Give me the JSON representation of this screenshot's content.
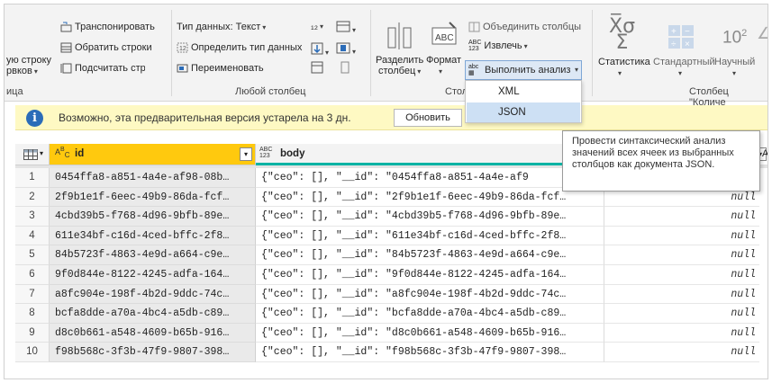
{
  "ribbon": {
    "left_cut": {
      "line1": "ую строку",
      "line2": "рвков",
      "group": "ица"
    },
    "transpose": "Транспонировать",
    "reverse_rows": "Обратить строки",
    "count_rows": "Подсчитать строки",
    "data_type": "Тип данных: Текст",
    "detect_type": "Определить тип данных",
    "rename": "Переименовать",
    "any_column_group": "Любой столбец",
    "split_column": {
      "line1": "Разделить",
      "line2": "столбец"
    },
    "format": "Формат",
    "merge_columns": "Объединить столбцы",
    "extract": "Извлечь",
    "parse": "Выполнить анализ",
    "text_column_group": "Стол",
    "statistics": "Статистика",
    "standard": "Стандартный",
    "scientific": "Научный",
    "number_column_group": "Столбец \"Количе",
    "ten_squared": "10",
    "ten_exp": "2",
    "abc": "ABC",
    "abc123": "ABC\n123"
  },
  "menu": {
    "items": [
      "XML",
      "JSON"
    ],
    "hovered_index": 1
  },
  "tooltip": "Провести синтаксический анализ значений всех ячеек из выбранных столбцов как документа JSON.",
  "infobar": {
    "message": "Возможно, эта предварительная версия устарела на 3 дн.",
    "refresh": "Обновить"
  },
  "grid": {
    "columns": [
      {
        "type_icon": "A B C",
        "name": "id"
      },
      {
        "type_icon": "ABC 123",
        "name": "body"
      }
    ],
    "last_header_letter": "A",
    "rows": [
      {
        "n": "1",
        "id": "0454ffa8-a851-4a4e-af98-08b…",
        "body": "{\"ceo\": [], \"__id\": \"0454ffa8-a851-4a4e-af9",
        "extra": "null"
      },
      {
        "n": "2",
        "id": "2f9b1e1f-6eec-49b9-86da-fcf…",
        "body": "{\"ceo\": [], \"__id\": \"2f9b1e1f-6eec-49b9-86da-fcf…",
        "extra": "null"
      },
      {
        "n": "3",
        "id": "4cbd39b5-f768-4d96-9bfb-89e…",
        "body": "{\"ceo\": [], \"__id\": \"4cbd39b5-f768-4d96-9bfb-89e…",
        "extra": "null"
      },
      {
        "n": "4",
        "id": "611e34bf-c16d-4ced-bffc-2f8…",
        "body": "{\"ceo\": [], \"__id\": \"611e34bf-c16d-4ced-bffc-2f8…",
        "extra": "null"
      },
      {
        "n": "5",
        "id": "84b5723f-4863-4e9d-a664-c9e…",
        "body": "{\"ceo\": [], \"__id\": \"84b5723f-4863-4e9d-a664-c9e…",
        "extra": "null"
      },
      {
        "n": "6",
        "id": "9f0d844e-8122-4245-adfa-164…",
        "body": "{\"ceo\": [], \"__id\": \"9f0d844e-8122-4245-adfa-164…",
        "extra": "null"
      },
      {
        "n": "7",
        "id": "a8fc904e-198f-4b2d-9ddc-74c…",
        "body": "{\"ceo\": [], \"__id\": \"a8fc904e-198f-4b2d-9ddc-74c…",
        "extra": "null"
      },
      {
        "n": "8",
        "id": "bcfa8dde-a70a-4bc4-a5db-c89…",
        "body": "{\"ceo\": [], \"__id\": \"bcfa8dde-a70a-4bc4-a5db-c89…",
        "extra": "null"
      },
      {
        "n": "9",
        "id": "d8c0b661-a548-4609-b65b-916…",
        "body": "{\"ceo\": [], \"__id\": \"d8c0b661-a548-4609-b65b-916…",
        "extra": "null"
      },
      {
        "n": "10",
        "id": "f98b568c-3f3b-47f9-9807-398…",
        "body": "{\"ceo\": [], \"__id\": \"f98b568c-3f3b-47f9-9807-398…",
        "extra": "null"
      }
    ]
  },
  "colors": {
    "id_header": "#ffc90e",
    "body_underline": "#00b3a4",
    "infobar": "#fef9c3",
    "info_icon": "#2b6cb8",
    "menu_hover": "#cde0f4"
  }
}
